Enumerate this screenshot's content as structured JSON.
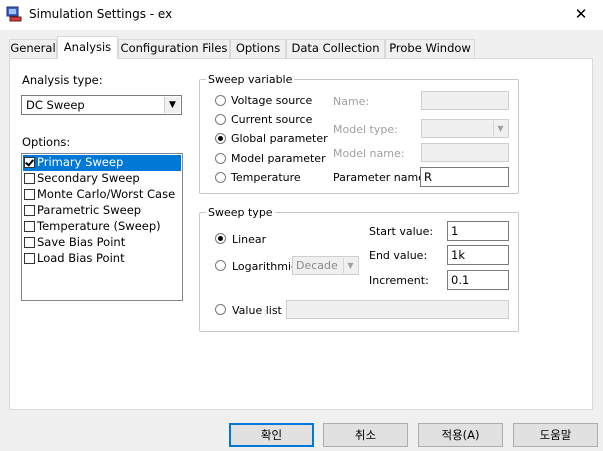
{
  "window": {
    "title": "Simulation Settings - ex",
    "close_glyph": "✕",
    "icon": "simulation-app-icon"
  },
  "tabs": [
    {
      "label": "General"
    },
    {
      "label": "Analysis",
      "active": true
    },
    {
      "label": "Configuration Files"
    },
    {
      "label": "Options"
    },
    {
      "label": "Data Collection"
    },
    {
      "label": "Probe Window"
    }
  ],
  "analysis": {
    "type_label": "Analysis type:",
    "type_value": "DC Sweep",
    "options_label": "Options:",
    "options": [
      {
        "label": "Primary Sweep",
        "checked": true,
        "selected": true
      },
      {
        "label": "Secondary Sweep",
        "checked": false
      },
      {
        "label": "Monte Carlo/Worst Case",
        "checked": false
      },
      {
        "label": "Parametric Sweep",
        "checked": false
      },
      {
        "label": "Temperature (Sweep)",
        "checked": false
      },
      {
        "label": "Save Bias Point",
        "checked": false
      },
      {
        "label": "Load Bias Point",
        "checked": false
      }
    ]
  },
  "sweep_variable": {
    "legend": "Sweep variable",
    "radios": [
      {
        "label": "Voltage source",
        "checked": false
      },
      {
        "label": "Current source",
        "checked": false
      },
      {
        "label": "Global parameter",
        "checked": true
      },
      {
        "label": "Model parameter",
        "checked": false
      },
      {
        "label": "Temperature",
        "checked": false
      }
    ],
    "name_label": "Name:",
    "model_type_label": "Model type:",
    "model_name_label": "Model name:",
    "parameter_name_label": "Parameter name:",
    "parameter_name_value": "R"
  },
  "sweep_type": {
    "legend": "Sweep type",
    "linear_label": "Linear",
    "log_label": "Logarithmic",
    "log_select_value": "Decade",
    "value_list_label": "Value list",
    "start_label": "Start value:",
    "start_value": "1",
    "end_label": "End value:",
    "end_value": "1k",
    "increment_label": "Increment:",
    "increment_value": "0.1"
  },
  "buttons": {
    "ok": "확인",
    "cancel": "취소",
    "apply": "적용(A)",
    "help": "도움말"
  },
  "colors": {
    "accent": "#0078d7",
    "selection": "#0078d7"
  }
}
